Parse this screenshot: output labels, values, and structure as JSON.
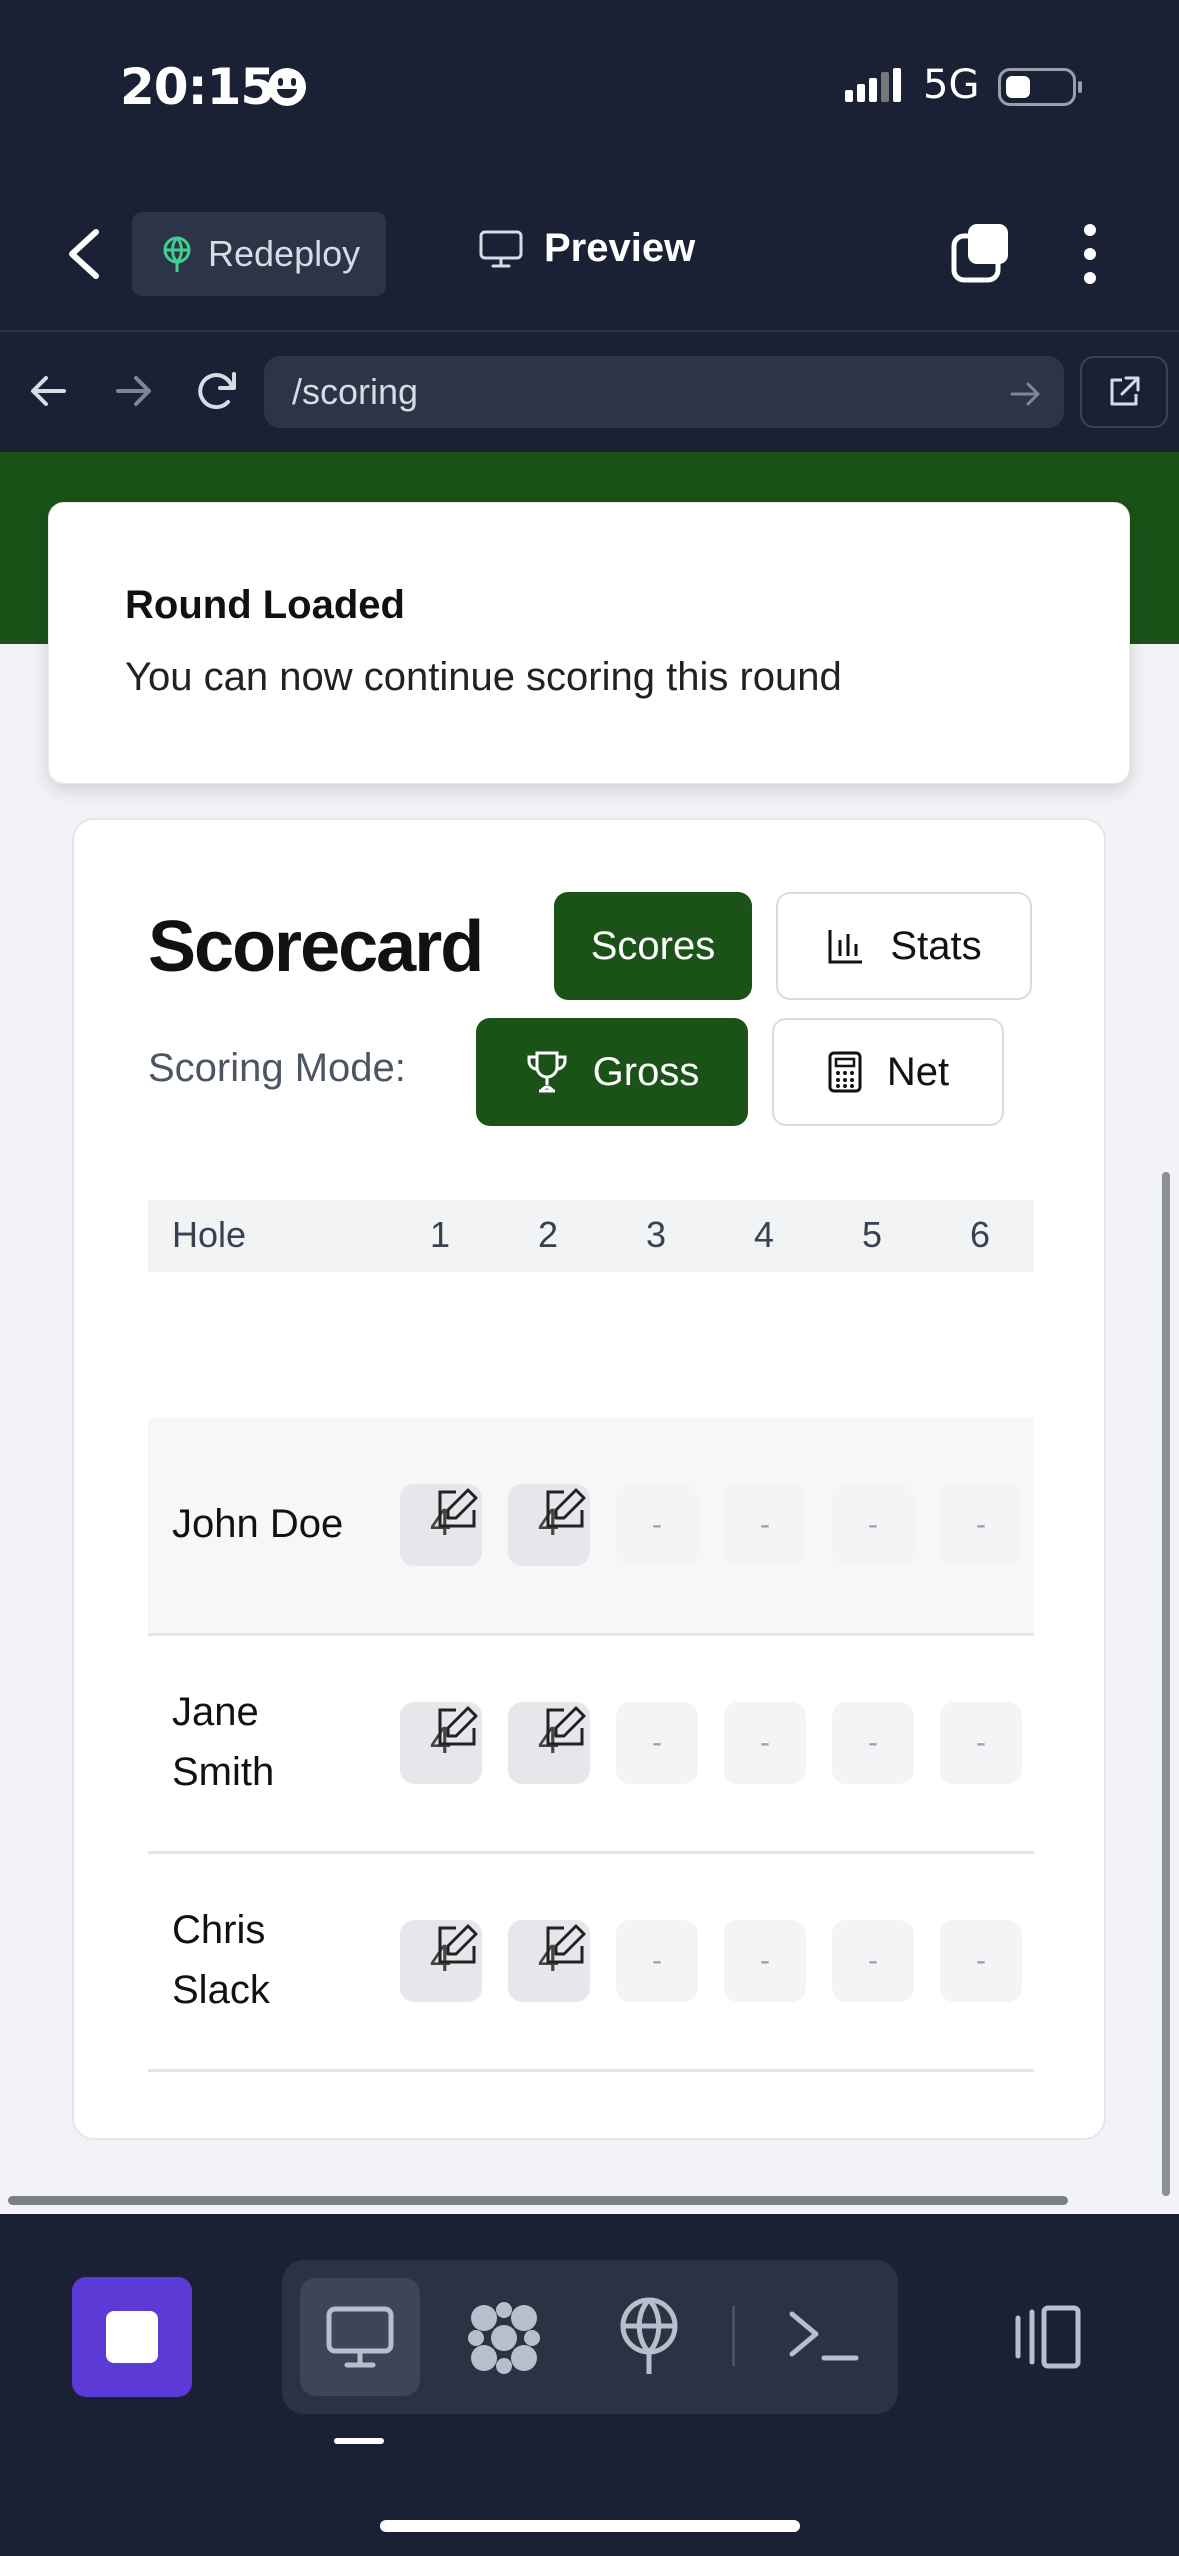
{
  "status_bar": {
    "time": "20:15",
    "network": "5G"
  },
  "app_bar": {
    "redeploy_label": "Redeploy",
    "preview_label": "Preview"
  },
  "browser": {
    "url": "/scoring"
  },
  "toast": {
    "title": "Round Loaded",
    "message": "You can now continue scoring this round"
  },
  "scorecard": {
    "title": "Scorecard",
    "view_tabs": {
      "scores": "Scores",
      "stats": "Stats"
    },
    "mode_label": "Scoring Mode:",
    "modes": {
      "gross": "Gross",
      "net": "Net"
    },
    "hole_header": "Hole",
    "holes": [
      "1",
      "2",
      "3",
      "4",
      "5",
      "6"
    ],
    "players": [
      {
        "name": "John Doe",
        "scores": [
          "4",
          "4",
          "-",
          "-",
          "-",
          "-"
        ]
      },
      {
        "name": "Jane Smith",
        "scores": [
          "4",
          "4",
          "-",
          "-",
          "-",
          "-"
        ]
      },
      {
        "name": "Chris Slack",
        "scores": [
          "4",
          "4",
          "-",
          "-",
          "-",
          "-"
        ]
      }
    ]
  },
  "colors": {
    "brand_green": "#1a5218",
    "dark_bg": "#1b2135",
    "accent_purple": "#5b3ad6"
  }
}
